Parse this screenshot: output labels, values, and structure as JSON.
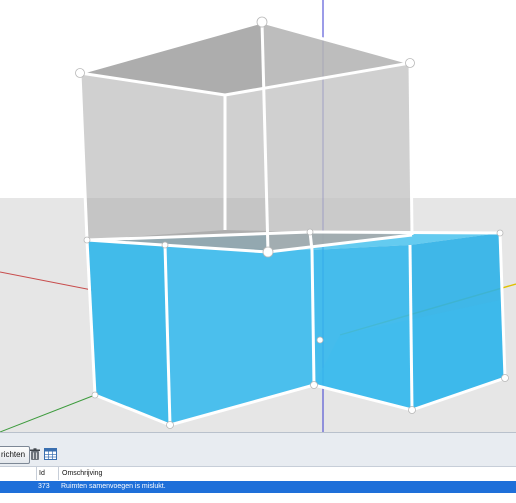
{
  "colors": {
    "sky": "#ffffff",
    "ground": "#e6e6e6",
    "upper_volume": "#a9a9a9",
    "lower_volume": "#2fb6ea",
    "edge": "#ffffff",
    "axis_red": "#c84d4d",
    "axis_green": "#3d9b3d",
    "axis_blue": "#3a3ad0",
    "axis_yellow": "#e0c000",
    "selection_row": "#1e6fd9"
  },
  "toolbar": {
    "messages_button_label": "richten",
    "delete_icon": "trash-icon",
    "table_icon": "table-icon"
  },
  "messages": {
    "columns": [
      "Id",
      "Omschrijving"
    ],
    "rows": [
      {
        "id": "373",
        "description": "Ruimten samenvoegen is mislukt."
      }
    ]
  }
}
